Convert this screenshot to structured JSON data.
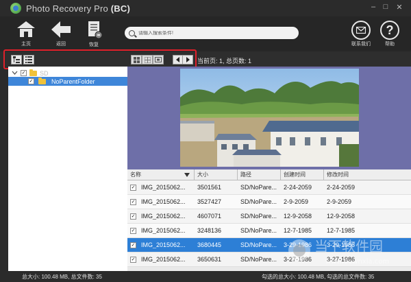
{
  "app": {
    "title": "Photo Recovery Pro",
    "edition": "(BC)"
  },
  "window": {
    "minimize": "–",
    "maximize": "□",
    "close": "✕"
  },
  "toolbar": {
    "home_label": "主页",
    "back_label": "返回",
    "recover_label": "恢复",
    "contact_label": "联系我们",
    "help_label": "帮助",
    "help_glyph": "?"
  },
  "search": {
    "placeholder": "请输入搜索条件!"
  },
  "pageinfo": "当前页: 1, 总页数: 1",
  "tree": {
    "root_label": "SD",
    "child_label": "NoParentFolder"
  },
  "table": {
    "columns": [
      "名称",
      "大小",
      "路径",
      "创建时间",
      "修改时间"
    ],
    "rows": [
      {
        "name": "IMG_2015062...",
        "size": "3501561",
        "path": "SD/NoPare...",
        "created": "2-24-2059",
        "modified": "2-24-2059",
        "checked": "✓"
      },
      {
        "name": "IMG_2015062...",
        "size": "3527427",
        "path": "SD/NoPare...",
        "created": "2-9-2059",
        "modified": "2-9-2059",
        "checked": "✓"
      },
      {
        "name": "IMG_2015062...",
        "size": "4607071",
        "path": "SD/NoPare...",
        "created": "12-9-2058",
        "modified": "12-9-2058",
        "checked": "✓"
      },
      {
        "name": "IMG_2015062...",
        "size": "3248136",
        "path": "SD/NoPare...",
        "created": "12-7-1985",
        "modified": "12-7-1985",
        "checked": "✓"
      },
      {
        "name": "IMG_2015062...",
        "size": "3680445",
        "path": "SD/NoPare...",
        "created": "3-29-1986",
        "modified": "3-29-1986",
        "checked": "✓"
      },
      {
        "name": "IMG_2015062...",
        "size": "3650631",
        "path": "SD/NoPare...",
        "created": "3-27-1986",
        "modified": "3-27-1986",
        "checked": "✓"
      }
    ]
  },
  "status": {
    "total": "总大小: 100.48 MB, 总文件数: 35",
    "selected_size": "勾选的总大小: 100.48 MB,",
    "selected_count": "勾选的总文件数: 35"
  },
  "watermark": {
    "line1": "当下软件园",
    "line2": "www.downxia.com"
  },
  "colors": {
    "accent": "#3e86d9",
    "highlight": "#e0202a",
    "preview_bg": "#6e6fa8"
  }
}
